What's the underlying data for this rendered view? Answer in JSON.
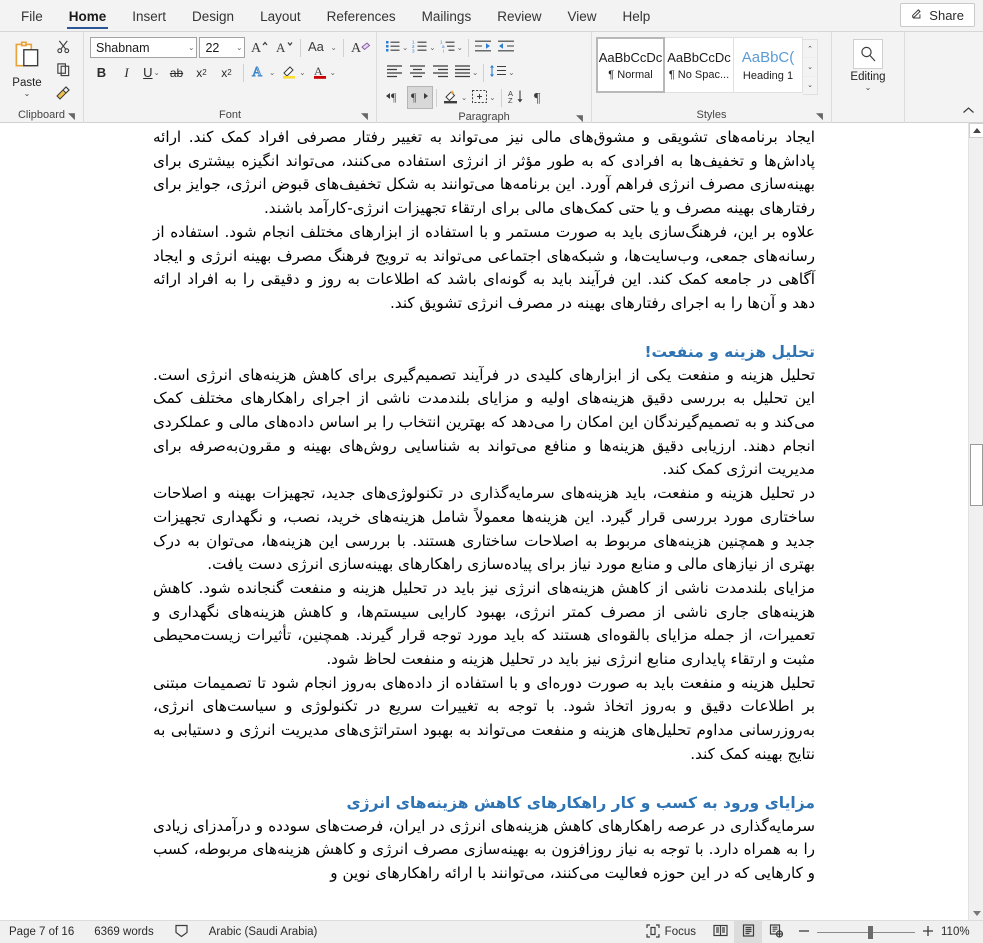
{
  "tabs": [
    {
      "label": "File",
      "active": false
    },
    {
      "label": "Home",
      "active": true
    },
    {
      "label": "Insert",
      "active": false
    },
    {
      "label": "Design",
      "active": false
    },
    {
      "label": "Layout",
      "active": false
    },
    {
      "label": "References",
      "active": false
    },
    {
      "label": "Mailings",
      "active": false
    },
    {
      "label": "Review",
      "active": false
    },
    {
      "label": "View",
      "active": false
    },
    {
      "label": "Help",
      "active": false
    }
  ],
  "share": {
    "label": "Share",
    "icon": "share-person-icon"
  },
  "ribbon": {
    "clipboard": {
      "group_label": "Clipboard",
      "paste_label": "Paste",
      "cut_icon": "scissors-icon",
      "copy_icon": "copy-icon",
      "format_painter_icon": "paint-brush-icon",
      "launcher": "◥"
    },
    "font": {
      "group_label": "Font",
      "font_name": "Shabnam",
      "font_size": "22",
      "grow_font_icon": "grow-font-icon",
      "shrink_font_icon": "shrink-font-icon",
      "change_case_icon": "change-case-icon",
      "clear_formatting_icon": "clear-formatting-icon",
      "bold_label": "B",
      "italic_label": "I",
      "underline_label": "U",
      "strikethrough_label": "ab",
      "subscript_label": "x",
      "superscript_label": "x",
      "text_effects_icon": "text-effects-icon",
      "highlight_icon": "text-highlight-icon",
      "font_color_icon": "font-color-icon",
      "launcher": "◥"
    },
    "paragraph": {
      "group_label": "Paragraph",
      "bullets_icon": "bullet-list-icon",
      "numbering_icon": "numbered-list-icon",
      "multilevel_icon": "multilevel-list-icon",
      "decrease_indent_icon": "decrease-indent-icon",
      "increase_indent_icon": "increase-indent-icon",
      "align_left_icon": "align-left-icon",
      "align_center_icon": "align-center-icon",
      "align_right_icon": "align-right-icon",
      "justify_icon": "justify-icon",
      "line_spacing_icon": "line-spacing-icon",
      "ltr_icon": "left-to-right-icon",
      "rtl_icon": "right-to-left-icon",
      "shading_icon": "shading-icon",
      "borders_icon": "borders-icon",
      "sort_icon": "sort-icon",
      "show_marks_icon": "show-formatting-marks-icon",
      "launcher": "◥"
    },
    "styles": {
      "group_label": "Styles",
      "items": [
        {
          "preview": "AaBbCcDc",
          "name": "¶ Normal",
          "selected": true
        },
        {
          "preview": "AaBbCcDc",
          "name": "¶ No Spac...",
          "selected": false
        },
        {
          "preview": "AaBbC(",
          "name": "Heading 1",
          "selected": false
        }
      ],
      "launcher": "◥"
    },
    "editing": {
      "group_label": "",
      "label": "Editing",
      "icon": "magnifier-icon"
    },
    "collapse_icon": "collapse-ribbon-icon"
  },
  "document": {
    "blocks": [
      {
        "type": "paragraph",
        "text": "ایجاد برنامه‌های تشویقی و مشوق‌های مالی نیز می‌تواند به تغییر رفتار مصرفی افراد کمک کند. ارائه پاداش‌ها و تخفیف‌ها به افرادی که به طور مؤثر از انرژی استفاده می‌کنند، می‌تواند انگیزه بیشتری برای بهینه‌سازی مصرف انرژی فراهم آورد. این برنامه‌ها می‌توانند به شکل تخفیف‌های قبوض انرژی، جوایز برای رفتارهای بهینه مصرف و یا حتی کمک‌های مالی برای ارتقاء تجهیزات انرژی-کارآمد باشند."
      },
      {
        "type": "paragraph",
        "text": "علاوه بر این، فرهنگ‌سازی باید به صورت مستمر و با استفاده از ابزارهای مختلف انجام شود. استفاده از رسانه‌های جمعی، وب‌سایت‌ها، و شبکه‌های اجتماعی می‌تواند به ترویج فرهنگ مصرف بهینه انرژی و ایجاد آگاهی در جامعه کمک کند. این فرآیند باید به گونه‌ای باشد که اطلاعات به روز و دقیقی را به افراد ارائه دهد و آن‌ها را به اجرای رفتارهای بهینه در مصرف انرژی تشویق کند."
      },
      {
        "type": "heading",
        "text": "تحلیل هزینه و منفعت!"
      },
      {
        "type": "paragraph",
        "text": "تحلیل هزینه و منفعت یکی از ابزارهای کلیدی در فرآیند تصمیم‌گیری برای کاهش هزینه‌های انرژی است. این تحلیل به بررسی دقیق هزینه‌های اولیه و مزایای بلندمدت ناشی از اجرای راهکارهای مختلف کمک می‌کند و به تصمیم‌گیرندگان این امکان را می‌دهد که بهترین انتخاب را بر اساس داده‌های مالی و عملکردی انجام دهند. ارزیابی دقیق هزینه‌ها و منافع می‌تواند به شناسایی روش‌های بهینه و مقرون‌به‌صرفه برای مدیریت انرژی کمک کند."
      },
      {
        "type": "paragraph",
        "text": "در تحلیل هزینه و منفعت، باید هزینه‌های سرمایه‌گذاری در تکنولوژی‌های جدید، تجهیزات بهینه و اصلاحات ساختاری مورد بررسی قرار گیرد. این هزینه‌ها معمولاً شامل هزینه‌های خرید، نصب، و نگهداری تجهیزات جدید و همچنین هزینه‌های مربوط به اصلاحات ساختاری هستند. با بررسی این هزینه‌ها، می‌توان به درک بهتری از نیازهای مالی و منابع مورد نیاز برای پیاده‌سازی راهکارهای بهینه‌سازی انرژی دست یافت."
      },
      {
        "type": "paragraph",
        "text": "مزایای بلندمدت ناشی از کاهش هزینه‌های انرژی نیز باید در تحلیل هزینه و منفعت گنجانده شود. کاهش هزینه‌های جاری ناشی از مصرف کمتر انرژی، بهبود کارایی سیستم‌ها، و کاهش هزینه‌های نگهداری و تعمیرات، از جمله مزایای بالقوه‌ای هستند که باید مورد توجه قرار گیرند. همچنین، تأثیرات زیست‌محیطی مثبت و ارتقاء پایداری منابع انرژی نیز باید در تحلیل هزینه و منفعت لحاظ شود."
      },
      {
        "type": "paragraph",
        "text": "تحلیل هزینه و منفعت باید به صورت دوره‌ای و با استفاده از داده‌های به‌روز انجام شود تا تصمیمات مبتنی بر اطلاعات دقیق و به‌روز اتخاذ شود. با توجه به تغییرات سریع در تکنولوژی و سیاست‌های انرژی، به‌روزرسانی مداوم تحلیل‌های هزینه و منفعت می‌تواند به بهبود استراتژی‌های مدیریت انرژی و دستیابی به نتایج بهینه کمک کند."
      },
      {
        "type": "heading",
        "text": "مزایای ورود به کسب و کار راهکارهای کاهش هزینه‌های انرژی"
      },
      {
        "type": "paragraph",
        "text": "سرمایه‌گذاری در عرصه راهکارهای کاهش هزینه‌های انرژی در ایران، فرصت‌های سودده و درآمدزای زیادی را به همراه دارد. با توجه به نیاز روزافزون به بهینه‌سازی مصرف انرژی و کاهش هزینه‌های مربوطه، کسب و کارهایی که در این حوزه فعالیت می‌کنند، می‌توانند با ارائه راهکارهای نوین و"
      }
    ]
  },
  "status": {
    "page": "Page 7 of 16",
    "words": "6369 words",
    "proofing_icon": "proofing-errors-icon",
    "language": "Arabic (Saudi Arabia)",
    "focus_label": "Focus",
    "focus_icon": "focus-mode-icon",
    "read_mode_icon": "read-mode-icon",
    "print_layout_icon": "print-layout-icon",
    "web_layout_icon": "web-layout-icon",
    "zoom_out_icon": "zoom-out-icon",
    "zoom_in_icon": "zoom-in-icon",
    "zoom_level": "110%"
  },
  "colors": {
    "accent_blue": "#2b579a",
    "heading_blue": "#2e74b5",
    "ribbon_bg": "#f3f3f3",
    "status_bg": "#f0f0f0"
  }
}
